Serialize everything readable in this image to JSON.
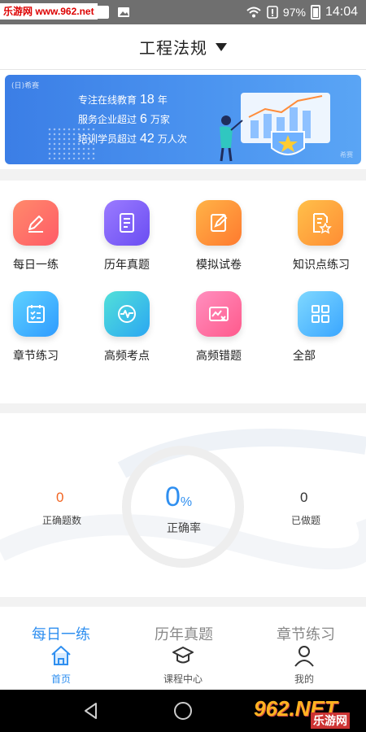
{
  "status_bar": {
    "watermark": "乐游网 www.962.net",
    "battery": "97%",
    "time": "14:04"
  },
  "header": {
    "title": "工程法规"
  },
  "banner": {
    "logo": "(日)希赛",
    "line1_pre": "专注在线教育",
    "line1_num": "18",
    "line1_post": "年",
    "line2_pre": "服务企业超过",
    "line2_num": "6",
    "line2_post": "万家",
    "line3_pre": "培训学员超过",
    "line3_num": "42",
    "line3_post": "万人次",
    "corner": "希赛"
  },
  "features": [
    {
      "label": "每日一练",
      "icon": "pencil-icon",
      "color_from": "#ff8a6b",
      "color_to": "#ff5b67"
    },
    {
      "label": "历年真题",
      "icon": "document-icon",
      "color_from": "#9b7bff",
      "color_to": "#6a4df2"
    },
    {
      "label": "模拟试卷",
      "icon": "edit-paper-icon",
      "color_from": "#ffb347",
      "color_to": "#ff7a2f"
    },
    {
      "label": "知识点练习",
      "icon": "star-doc-icon",
      "color_from": "#ffc04a",
      "color_to": "#ff8d34"
    },
    {
      "label": "章节练习",
      "icon": "checklist-icon",
      "color_from": "#5ed2ff",
      "color_to": "#2f9bff"
    },
    {
      "label": "高频考点",
      "icon": "pulse-icon",
      "color_from": "#52e0d9",
      "color_to": "#2ba7f2"
    },
    {
      "label": "高频错题",
      "icon": "chart-error-icon",
      "color_from": "#ff8fbf",
      "color_to": "#ff5a8c"
    },
    {
      "label": "全部",
      "icon": "grid-icon",
      "color_from": "#7fd8ff",
      "color_to": "#3aa6ff"
    }
  ],
  "stats": {
    "correct_count": "0",
    "correct_count_label": "正确题数",
    "correct_rate": "0",
    "correct_rate_unit": "%",
    "correct_rate_label": "正确率",
    "done_count": "0",
    "done_count_label": "已做题"
  },
  "top_tabs": [
    "每日一练",
    "历年真题",
    "章节练习"
  ],
  "nav": [
    {
      "label": "首页",
      "icon": "home-icon"
    },
    {
      "label": "课程中心",
      "icon": "graduation-cap-icon"
    },
    {
      "label": "我的",
      "icon": "user-icon"
    }
  ],
  "sys_watermark": {
    "big": "962.NET",
    "sub": "乐游网"
  },
  "colors": {
    "accent": "#2f8ff0",
    "correct_count": "#f26522"
  }
}
